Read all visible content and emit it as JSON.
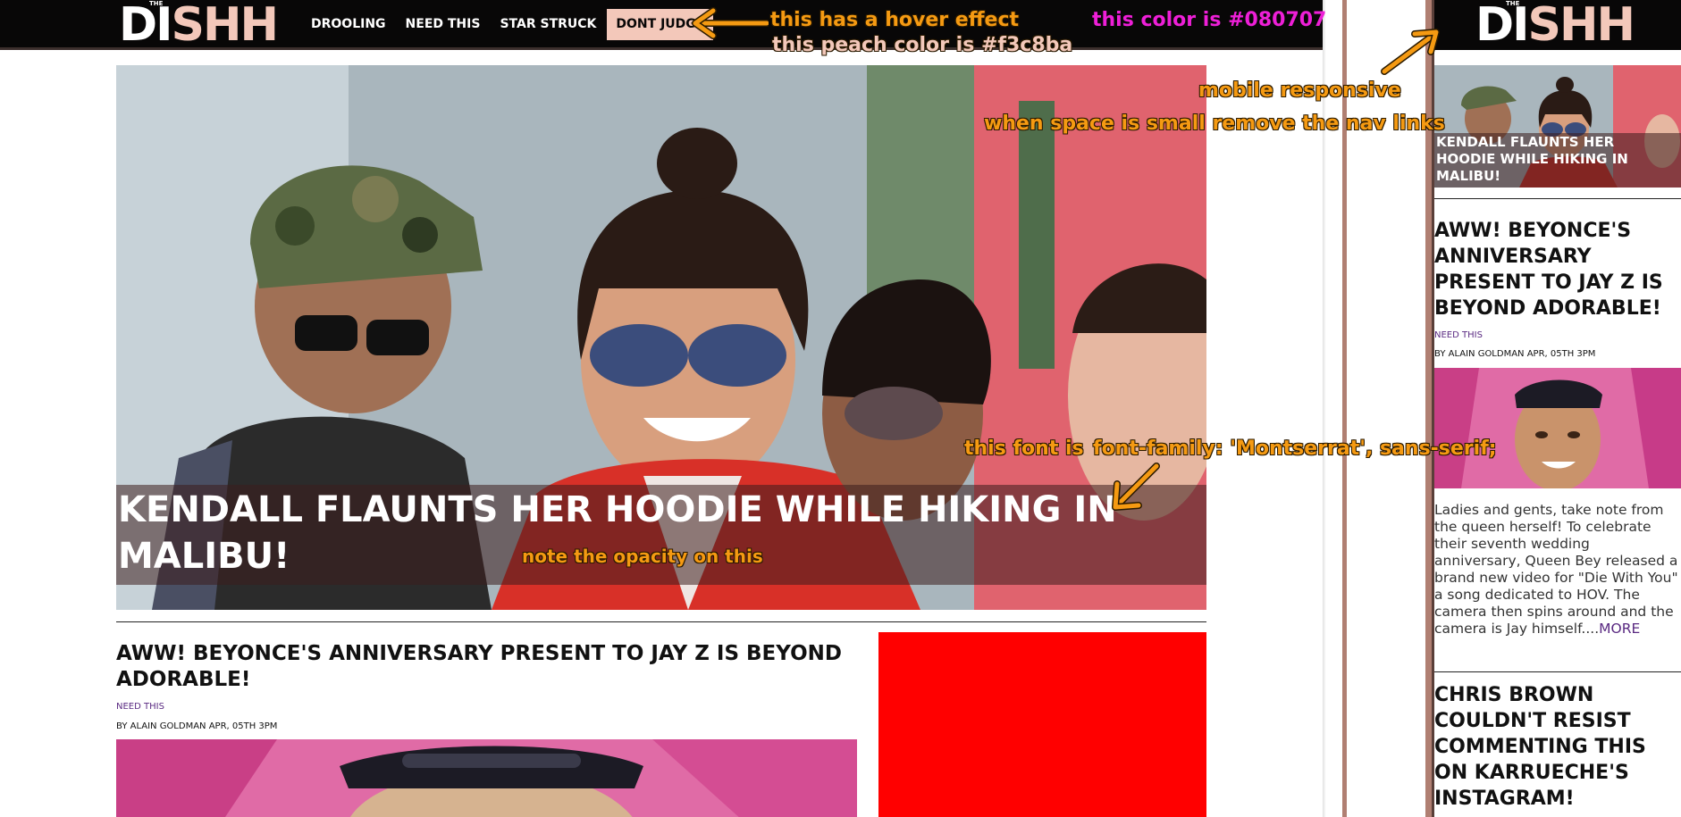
{
  "brand": {
    "logo_the": "THE",
    "logo_part1": "DI",
    "logo_part2": "SHH"
  },
  "nav": {
    "items": [
      {
        "label": "DROOLING"
      },
      {
        "label": "NEED THIS"
      },
      {
        "label": "STAR STRUCK"
      },
      {
        "label": "DONT JUDGE"
      }
    ]
  },
  "hero": {
    "title": "KENDALL FLAUNTS HER HOODIE WHILE HIKING IN MALIBU!"
  },
  "article": {
    "title": "AWW! BEYONCE'S ANNIVERSARY PRESENT TO JAY Z IS BEYOND ADORABLE!",
    "category": "NEED THIS",
    "byline": "BY ALAIN GOLDMAN APR, 05TH 3PM",
    "excerpt": "Ladies and gents, take note from the queen herself! To celebrate their seventh wedding anniversary, Queen Bey released a brand new video for \"Die With You\" a song dedicated to HOV. The camera then spins around and the camera is Jay himself....",
    "more": "MORE"
  },
  "article2": {
    "title": "CHRIS BROWN COULDN'T RESIST COMMENTING THIS ON KARRUECHE'S INSTAGRAM!"
  },
  "annotations": {
    "hover": "this has a hover effect",
    "color": "this color is #080707",
    "peach": "this peach color is #f3c8ba",
    "mobile": "mobile responsive",
    "remove": "when space is small remove the nav links",
    "font_prefix": "this font is",
    "font_value": "font-family: 'Montserrat', sans-serif;",
    "opacity": "note the opacity on this"
  },
  "colors": {
    "nav_bg": "#080707",
    "peach": "#f3c8ba",
    "ad": "#ff0000",
    "category": "#5a2a82",
    "annotation_orange": "#f59a12",
    "annotation_magenta": "#ee1fd7"
  }
}
